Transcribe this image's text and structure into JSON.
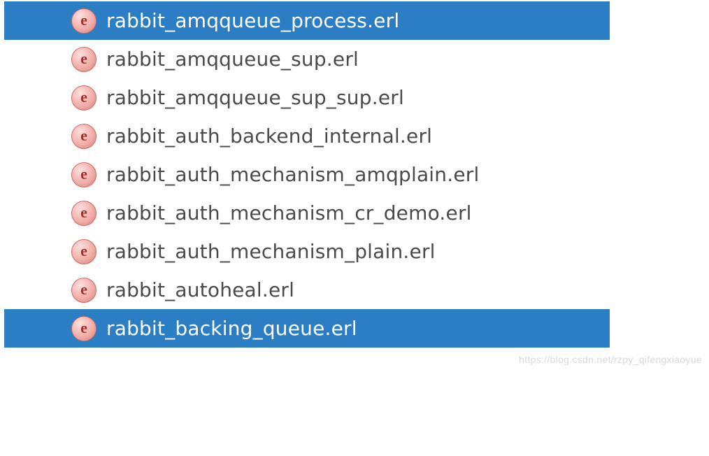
{
  "icon_letter": "e",
  "watermark": "https://blog.csdn.net/rzpy_qifengxiaoyue",
  "files": [
    {
      "name": "rabbit_amqqueue_process.erl",
      "selected": true
    },
    {
      "name": "rabbit_amqqueue_sup.erl",
      "selected": false
    },
    {
      "name": "rabbit_amqqueue_sup_sup.erl",
      "selected": false
    },
    {
      "name": "rabbit_auth_backend_internal.erl",
      "selected": false
    },
    {
      "name": "rabbit_auth_mechanism_amqplain.erl",
      "selected": false
    },
    {
      "name": "rabbit_auth_mechanism_cr_demo.erl",
      "selected": false
    },
    {
      "name": "rabbit_auth_mechanism_plain.erl",
      "selected": false
    },
    {
      "name": "rabbit_autoheal.erl",
      "selected": false
    },
    {
      "name": "rabbit_backing_queue.erl",
      "selected": true
    }
  ]
}
